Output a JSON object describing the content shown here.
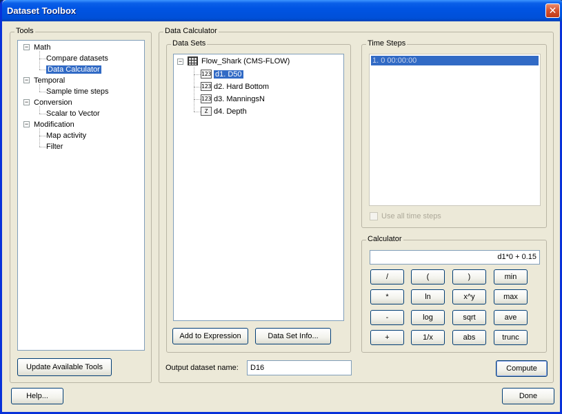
{
  "window": {
    "title": "Dataset Toolbox",
    "close_glyph": "✕"
  },
  "tools": {
    "label": "Tools",
    "tree": [
      {
        "label": "Math",
        "children": [
          "Compare datasets",
          "Data Calculator"
        ]
      },
      {
        "label": "Temporal",
        "children": [
          "Sample time steps"
        ]
      },
      {
        "label": "Conversion",
        "children": [
          "Scalar to Vector"
        ]
      },
      {
        "label": "Modification",
        "children": [
          "Map activity",
          "Filter"
        ]
      }
    ],
    "selected": "Data Calculator",
    "update_button": "Update Available Tools"
  },
  "data_calculator": {
    "label": "Data Calculator",
    "data_sets": {
      "label": "Data Sets",
      "root": "Flow_Shark (CMS-FLOW)",
      "items": [
        {
          "label": "d1. D50",
          "icon": "123",
          "selected": true
        },
        {
          "label": "d2. Hard Bottom",
          "icon": "123"
        },
        {
          "label": "d3. ManningsN",
          "icon": "123"
        },
        {
          "label": "d4. Depth",
          "icon": "Z"
        }
      ],
      "add_button": "Add to Expression",
      "info_button": "Data Set Info..."
    },
    "time_steps": {
      "label": "Time Steps",
      "items": [
        "1. 0 00:00:00"
      ],
      "use_all_label": "Use all time steps"
    },
    "calculator": {
      "label": "Calculator",
      "expression": "d1*0 + 0.15",
      "keys": [
        [
          "/",
          "(",
          ")",
          "min"
        ],
        [
          "*",
          "ln",
          "x^y",
          "max"
        ],
        [
          "-",
          "log",
          "sqrt",
          "ave"
        ],
        [
          "+",
          "1/x",
          "abs",
          "trunc"
        ]
      ]
    },
    "output_label": "Output dataset name:",
    "output_value": "D16",
    "compute_button": "Compute"
  },
  "footer": {
    "help_button": "Help...",
    "done_button": "Done"
  },
  "icons": {
    "expander_minus": "−"
  }
}
